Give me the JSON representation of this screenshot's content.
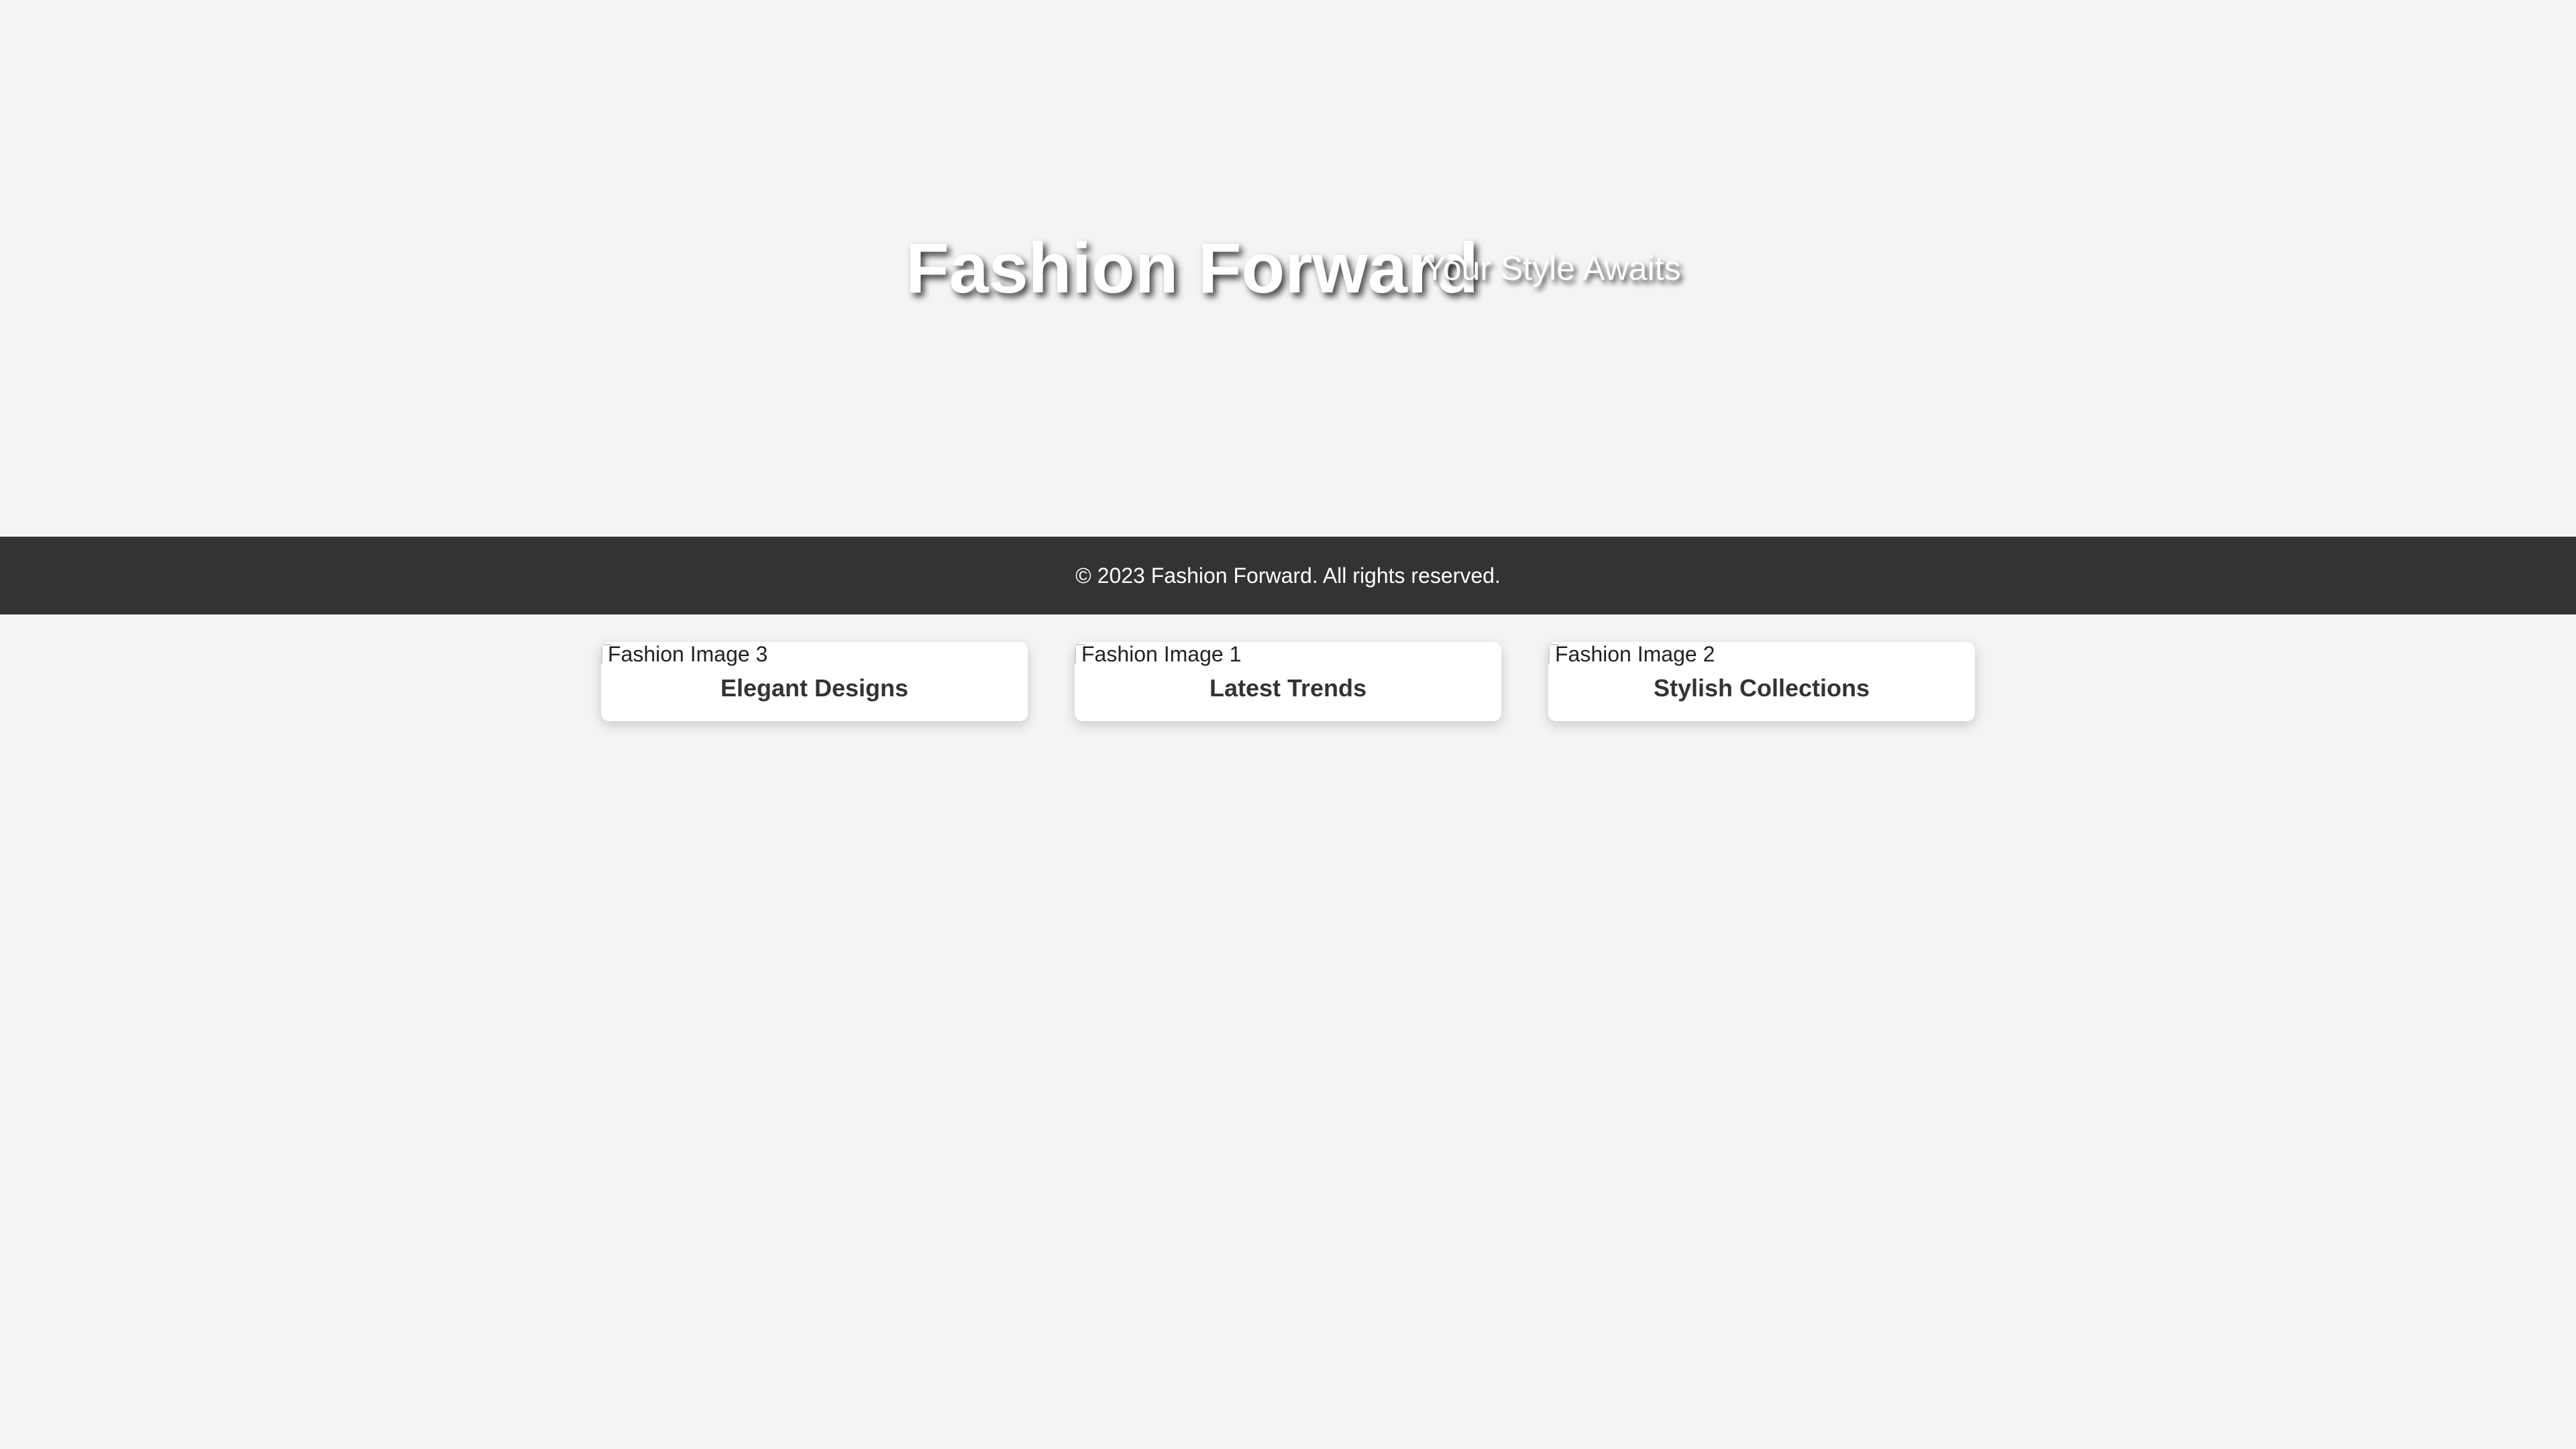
{
  "hero": {
    "title": "Fashion Forward",
    "subtitle": "Your Style Awaits"
  },
  "footer": {
    "text": "© 2023 Fashion Forward. All rights reserved."
  },
  "gallery": {
    "cards": [
      {
        "image_alt": "Fashion Image 3",
        "title": "Elegant Designs"
      },
      {
        "image_alt": "Fashion Image 1",
        "title": "Latest Trends"
      },
      {
        "image_alt": "Fashion Image 2",
        "title": "Stylish Collections"
      }
    ]
  },
  "colors": {
    "background": "#f4f4f4",
    "footer_bg": "#333333",
    "card_bg": "#ffffff",
    "hero_text": "#ffffff"
  }
}
